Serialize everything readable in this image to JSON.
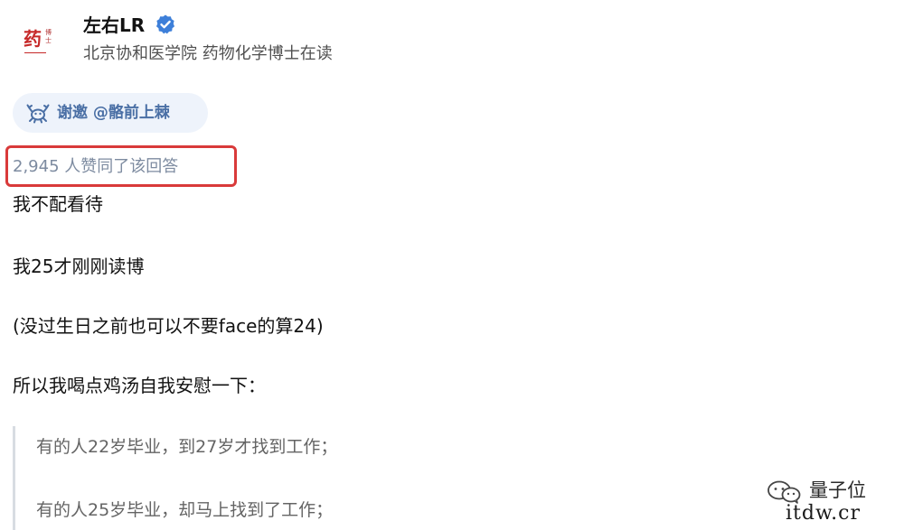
{
  "author": {
    "avatar_text": "药",
    "avatar_subtext": "博士",
    "name": "左右LR",
    "headline": "北京协和医学院 药物化学博士在读",
    "verified_icon": "verified-badge-icon"
  },
  "invite": {
    "icon": "crab-icon",
    "label": "谢邀 @骼前上棘"
  },
  "votes": {
    "label": "2,945 人赞同了该回答"
  },
  "answer": {
    "paragraphs": [
      "我不配看待",
      "我25才刚刚读博",
      "(没过生日之前也可以不要face的算24)",
      "所以我喝点鸡汤自我安慰一下："
    ],
    "quote": [
      "有的人22岁毕业，到27岁才找到工作；",
      "有的人25岁毕业，却马上找到了工作；"
    ]
  },
  "watermark": {
    "icon": "wechat-icon",
    "name": "量子位",
    "site": "itdw.cr"
  },
  "colors": {
    "highlight": "#d93a3a",
    "invite_bg": "#eef3fb",
    "invite_text": "#4a6fa5",
    "verified": "#3d7fd9"
  }
}
